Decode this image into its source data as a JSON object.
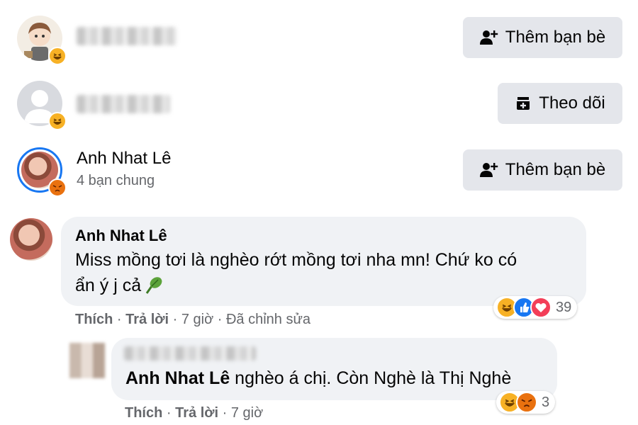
{
  "people": [
    {
      "name": "",
      "mutual": "",
      "button": {
        "label": "Thêm bạn bè",
        "icon": "add-friend-icon"
      },
      "badge": "haha-reaction"
    },
    {
      "name": "",
      "mutual": "",
      "button": {
        "label": "Theo dõi",
        "icon": "follow-icon"
      },
      "badge": "haha-reaction"
    },
    {
      "name": "Anh Nhat Lê",
      "mutual": "4 bạn chung",
      "button": {
        "label": "Thêm bạn bè",
        "icon": "add-friend-icon"
      },
      "badge": "angry-reaction"
    }
  ],
  "comments": [
    {
      "author": "Anh Nhat Lê",
      "text_line1": "Miss mồng tơi là nghèo rớt mồng tơi nha mn! Chứ ko có",
      "text_line2": "ẩn ý j cả",
      "actions": {
        "like": "Thích",
        "reply": "Trả lời",
        "time": "7 giờ",
        "edited": "Đã chỉnh sửa"
      },
      "reactions": {
        "types": [
          "haha",
          "like",
          "love"
        ],
        "count": "39"
      }
    },
    {
      "author": "",
      "tag": "Anh Nhat Lê",
      "text": " nghèo á chị. Còn Nghè là Thị Nghè",
      "actions": {
        "like": "Thích",
        "reply": "Trả lời",
        "time": "7 giờ"
      },
      "reactions": {
        "types": [
          "haha",
          "angry"
        ],
        "count": "3"
      }
    }
  ],
  "separator": " · ",
  "colors": {
    "button_bg": "#e4e6eb",
    "bubble_bg": "#f0f2f5",
    "meta_gray": "#65676b",
    "like_blue": "#1877f2",
    "haha_yellow": "#f7b125",
    "love_red": "#f33e58",
    "angry_orange": "#e9710f"
  }
}
